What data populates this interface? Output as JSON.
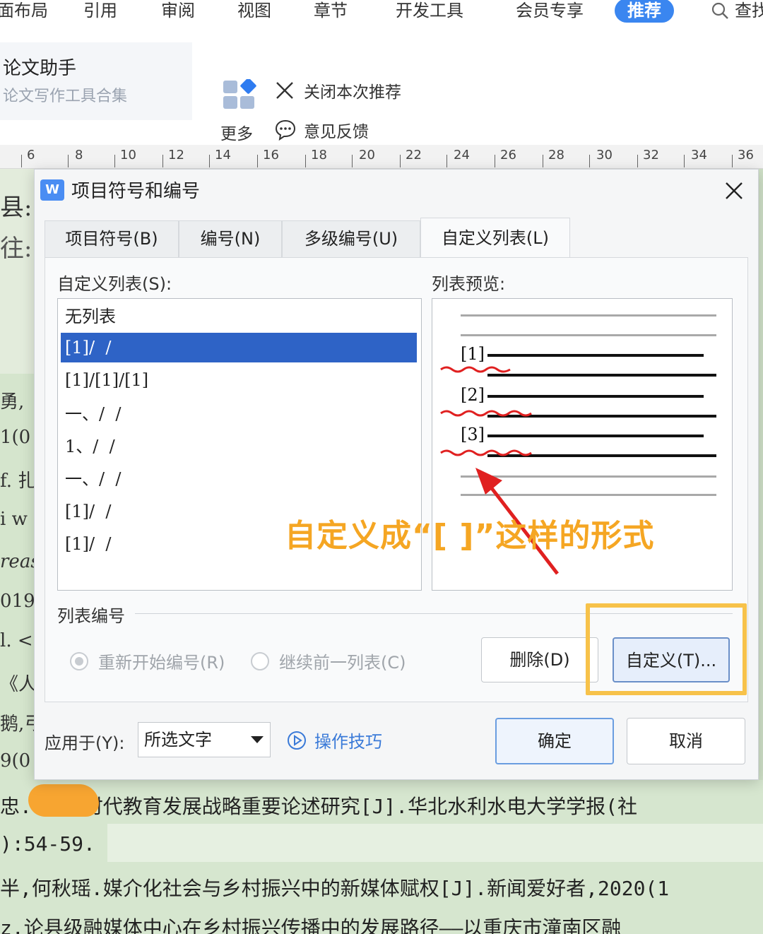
{
  "ribbon": {
    "tabs": [
      {
        "label": "页面布局",
        "display": "面布局"
      },
      {
        "label": "引用"
      },
      {
        "label": "审阅"
      },
      {
        "label": "视图"
      },
      {
        "label": "章节"
      },
      {
        "label": "开发工具"
      },
      {
        "label": "会员专享"
      },
      {
        "label": "推荐"
      },
      {
        "label": "查找"
      }
    ],
    "paper_title": "论文助手",
    "paper_subtitle": "论文写作工具合集",
    "more_label": "更多",
    "close_recommend": "关闭本次推荐",
    "feedback": "意见反馈"
  },
  "ruler": {
    "marks": [
      "6",
      "8",
      "10",
      "12",
      "14",
      "16",
      "18",
      "20",
      "22",
      "24",
      "26",
      "28",
      "30",
      "32",
      "34",
      "36"
    ]
  },
  "document": {
    "left_fragments": [
      "县:",
      "往:",
      "勇,",
      "1(0",
      "f. 扎",
      "i w",
      "reas",
      "019",
      "l. <",
      "《人",
      "鹅,弓",
      "9(0"
    ],
    "lines": [
      "忠. 习新时代教育发展战略重要论述研究[J].华北水利水电大学学报(社",
      "):54-59.",
      "半,何秋瑶.媒介化社会与乡村振兴中的新媒体赋权[J].新闻爱好者,2020(1",
      "z.论县级融媒体中心在乡村振兴传播中的发展路径——以重庆市潼南区融"
    ]
  },
  "dialog": {
    "app_icon": "W",
    "title": "项目符号和编号",
    "tabs": [
      "项目符号(B)",
      "编号(N)",
      "多级编号(U)",
      "自定义列表(L)"
    ],
    "list_label": "自定义列表(S):",
    "preview_label": "列表预览:",
    "list_items": [
      "无列表",
      "[1]/  /",
      "[1]/[1]/[1]",
      "一、/  /",
      "1、/  /",
      "一、/  /",
      "[1]/  /",
      "[1]/  /"
    ],
    "preview_numbers": [
      "[1]",
      "[2]",
      "[3]"
    ],
    "annotation": "自定义成“[  ]”这样的形式",
    "numbering_label": "列表编号",
    "restart_label": "重新开始编号(R)",
    "continue_label": "继续前一列表(C)",
    "delete_button": "删除(D)",
    "customize_button": "自定义(T)...",
    "apply_label": "应用于(Y):",
    "apply_value": "所选文字",
    "tips_label": "操作技巧",
    "ok_button": "确定",
    "cancel_button": "取消"
  },
  "colors": {
    "accent": "#3a86f0",
    "selection": "#2e63c6",
    "annotation": "#f5a623",
    "highlight": "#f7c24a",
    "arrow": "#e02020"
  }
}
